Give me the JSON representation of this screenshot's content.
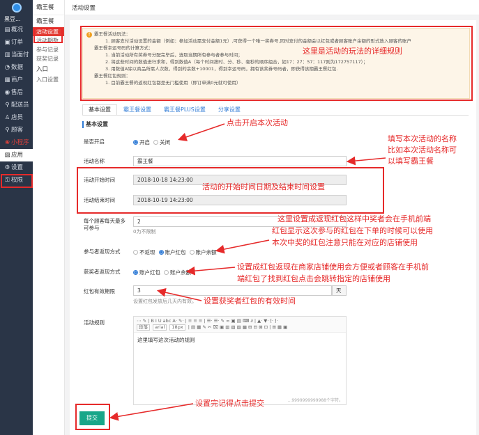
{
  "nav": {
    "brand": "黑豆...",
    "items": [
      {
        "label": "概况",
        "icon": "overview-icon",
        "glyph": "▤"
      },
      {
        "label": "订单",
        "icon": "order-icon",
        "glyph": "▣"
      },
      {
        "label": "当面付",
        "icon": "pay-icon",
        "glyph": "▥"
      },
      {
        "label": "数据",
        "icon": "data-icon",
        "glyph": "◔"
      },
      {
        "label": "商户",
        "icon": "merchant-icon",
        "glyph": "▦"
      },
      {
        "label": "售后",
        "icon": "aftersale-icon",
        "glyph": "◉"
      },
      {
        "label": "配送员",
        "icon": "courier-icon",
        "glyph": "⚲"
      },
      {
        "label": "店员",
        "icon": "clerk-icon",
        "glyph": "♙"
      },
      {
        "label": "顾客",
        "icon": "customer-icon",
        "glyph": "⚲"
      },
      {
        "label": "小程序",
        "icon": "miniapp-icon",
        "glyph": "❀"
      },
      {
        "label": "应用",
        "icon": "app-icon",
        "glyph": "▨"
      },
      {
        "label": "设置",
        "icon": "settings-icon",
        "glyph": "⚙"
      },
      {
        "label": "权限",
        "icon": "permission-icon",
        "glyph": "⚿"
      }
    ]
  },
  "submenu": {
    "head": "霸王餐",
    "group1": "霸王餐",
    "links": [
      "活动设置",
      "活动期数",
      "参与记录",
      "获奖记录"
    ],
    "group2": "入口",
    "links2": [
      "入口设置"
    ]
  },
  "topbar": {
    "title": "活动设置"
  },
  "notice": {
    "title": "霸王餐活动玩法：",
    "lines": [
      "1. 顾客支付活动设置的金额（例如：参加活动需支付金额1元）,可获得一个唯一奖券号,同时支付的金额会以红包或者顾客账户余额的形式放入顾客的账户",
      "霸王餐幸运号码的计算方式：",
      "1. 当前活动所有奖券号分配完毕后，选取当期所有参与者参与时间；",
      "2. 将这些时间的数值进行求和，得到数值A（每个时间按时、分、秒、毫秒的顺序组合，如17：27：57：117则为172757117）；",
      "3. 用数值A除以商品所需人次数，得到的余数+10001，得到幸运号码，拥有该奖券号码者，即获得该期霸王餐红包.",
      "霸王餐红包规则：",
      "1. 目前霸王餐的返现红包都是无门槛使用（即订单满0元就可使用）"
    ]
  },
  "tabs": [
    "基本设置",
    "霸王餐设置",
    "霸王餐PLUS设置",
    "分享设置"
  ],
  "section": "基本设置",
  "form": {
    "enabled_label": "是否开启",
    "enabled_on": "开启",
    "enabled_off": "关闭",
    "name_label": "活动名称",
    "name_value": "霸王餐",
    "start_label": "活动开始时间",
    "start_value": "2018-10-18 14:23:00",
    "end_label": "活动结束时间",
    "end_value": "2018-10-19 14:23:00",
    "limit_label": "每个顾客每天最多可参与",
    "limit_value": "2",
    "limit_hint": "0为不限制",
    "refund_label": "参与者返现方式",
    "refund_options": [
      "不返现",
      "账户红包",
      "账户余额"
    ],
    "winner_label": "获奖者返现方式",
    "winner_options": [
      "账户红包",
      "账户余额"
    ],
    "valid_label": "红包有效期限",
    "valid_value": "3",
    "valid_unit": "天",
    "valid_hint": "设置红包发放后几天内有效。",
    "rules_label": "活动规则",
    "editor_text": "这里填写这次活动的规则",
    "editor_count": "...9999999999988个字符。",
    "toolbar_row1": "⋯ ✎ | B I U abc A· ✎· | ≡ ≡ ≡ | ☰· ☰· ✎ ∞ ▣ ▤ ⌨ ∂ | ▲· ▼· ⁅· ⁆·",
    "toolbar_para": "段落",
    "toolbar_font": "arial",
    "toolbar_size": "18px",
    "toolbar_row2": "| ▤ ▦ ✎ ✂ ⌧ ▣ ▥ ▧ ▨ ▩ ⊞ ⊟ ⊠ ⊡ | ⊞ ▦ ▣",
    "submit": "提交"
  },
  "annotations": {
    "rules": "这里是活动的玩法的详细规则",
    "enable": "点击开启本次活动",
    "name1": "填写本次活动的名称",
    "name2": "比如本次活动名称可",
    "name3": "以填写霸王餐",
    "time": "活动的开始时间日期及结束时间设置",
    "refund1": "这里设置成返现红包这样中奖者会在手机前端",
    "refund2": "红包显示这次参与的红包在下单的时候可以使用",
    "refund3": "本次中奖的红包注意只能在对应的店铺使用",
    "winner1": "设置成红包返现在商家店铺使用会方便或者顾客在手机前",
    "winner2": "端红包了找到红包点击会跳转指定的店铺使用",
    "valid": "设置获奖者红包的有效时间",
    "submit": "设置完记得点击提交"
  },
  "colors": {
    "accent": "#2f7bd6",
    "annotation": "#e62a2a",
    "submit": "#18a689",
    "nav_bg": "#2a3547"
  }
}
